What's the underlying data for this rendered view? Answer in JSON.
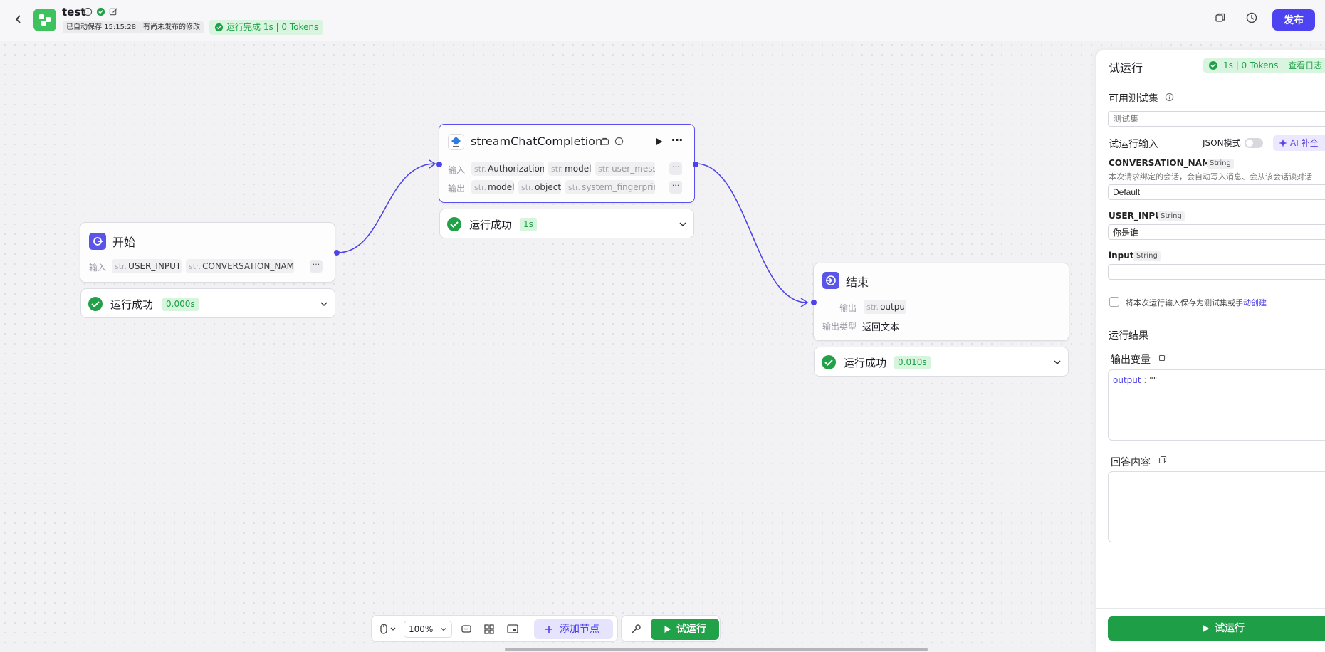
{
  "header": {
    "app_name": "test",
    "autosave": "已自动保存 15:15:28",
    "unpublished": "有尚未发布的修改",
    "run_status": "运行完成 1s | 0 Tokens",
    "publish_label": "发布"
  },
  "nodes": {
    "start": {
      "title": "开始",
      "input_label": "输入",
      "inputs": [
        {
          "type": "str.",
          "name": "USER_INPUT"
        },
        {
          "type": "str.",
          "name": "CONVERSATION_NAME"
        }
      ],
      "more": "···",
      "status": "运行成功",
      "duration": "0.000s"
    },
    "api": {
      "title": "streamChatCompletion",
      "input_label": "输入",
      "output_label": "输出",
      "inputs": [
        {
          "type": "str.",
          "name": "Authorization"
        },
        {
          "type": "str.",
          "name": "model"
        },
        {
          "type": "str.",
          "name": "user_mess"
        }
      ],
      "outputs": [
        {
          "type": "str.",
          "name": "model"
        },
        {
          "type": "str.",
          "name": "object"
        },
        {
          "type": "str.",
          "name": "system_fingerprin"
        }
      ],
      "more": "···",
      "status": "运行成功",
      "duration": "1s"
    },
    "end": {
      "title": "结束",
      "output_label": "输出",
      "output_var": {
        "type": "str.",
        "name": "output"
      },
      "output_type_label": "输出类型",
      "output_type_value": "返回文本",
      "status": "运行成功",
      "duration": "0.010s"
    }
  },
  "toolbar": {
    "zoom": "100%",
    "add_node": "添加节点",
    "test_run": "试运行"
  },
  "panel": {
    "title": "试运行",
    "badge": "1s | 0 Tokens",
    "view_log": "查看日志",
    "testset_label": "可用测试集",
    "testset_placeholder": "测试集",
    "run_input_label": "试运行输入",
    "json_mode": "JSON模式",
    "ai_fill": "AI 补全",
    "vars": [
      {
        "name": "CONVERSATION_NAME",
        "type": "String",
        "desc": "本次请求绑定的会话，会自动写入消息、会从该会话读对话",
        "value": "Default"
      },
      {
        "name": "USER_INPUT",
        "type": "String",
        "value": "你是谁"
      },
      {
        "name": "input",
        "type": "String",
        "value": ""
      }
    ],
    "save_text": "将本次运行输入保存为测试集或",
    "save_link": "手动创建",
    "result_label": "运行结果",
    "output_vars_label": "输出变量",
    "output_key": "output",
    "output_sep": " : ",
    "output_value": "\"\"",
    "answer_label": "回答内容",
    "run_button": "试运行"
  },
  "colors": {
    "accent": "#4d43f0",
    "success": "#21a148",
    "success_bg": "#d9f5df"
  }
}
